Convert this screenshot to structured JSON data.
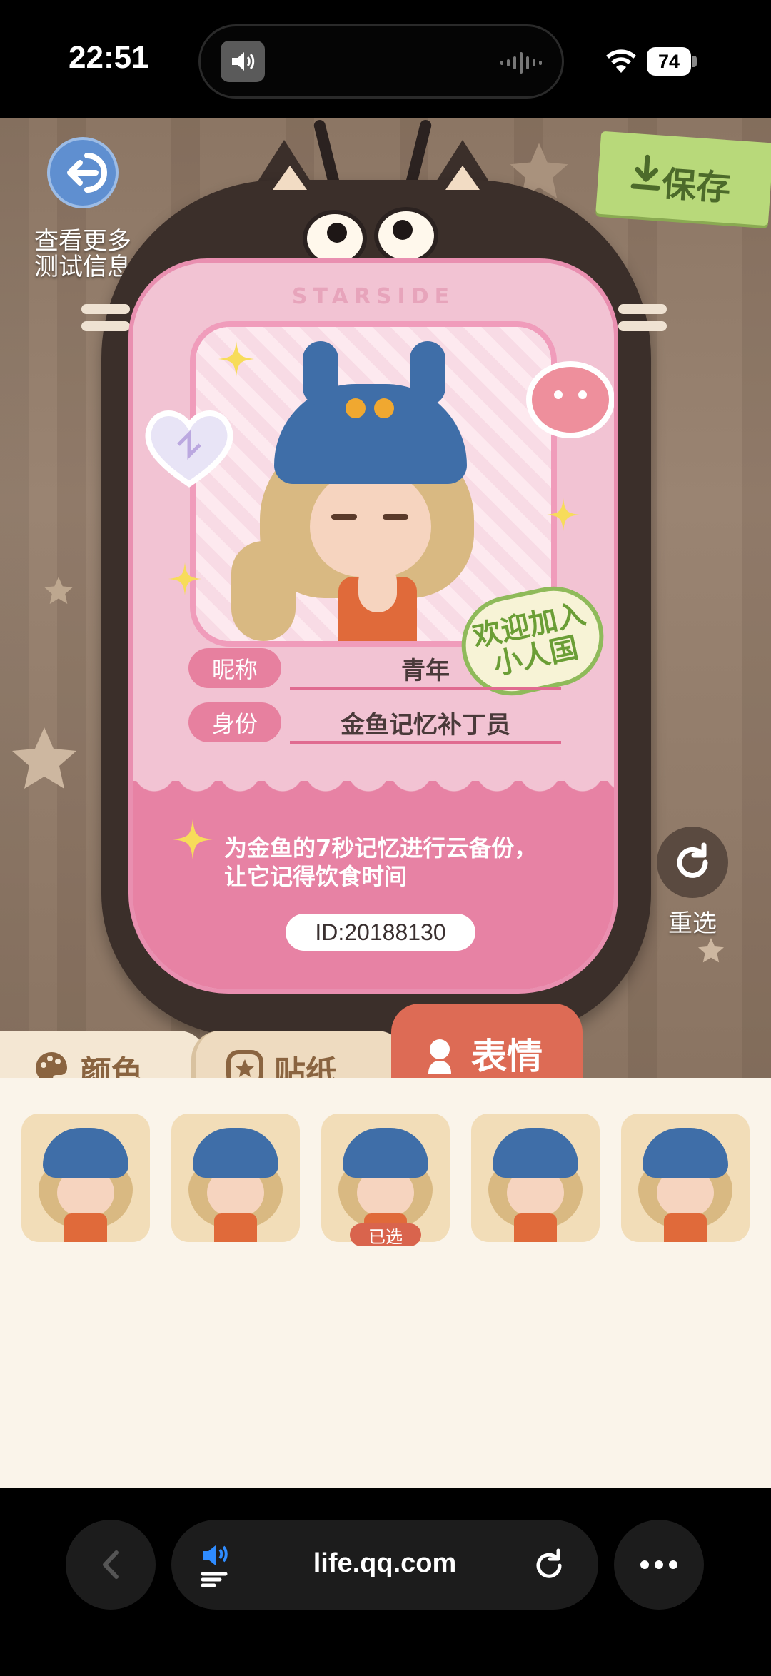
{
  "status_bar": {
    "time": "22:51",
    "battery": "74"
  },
  "page": {
    "more_info_label": "查看更多\n测试信息",
    "save_label": "保存",
    "brand": "STARSIDE",
    "welcome_sticker": "欢迎加入\n小人国",
    "nickname_label": "昵称",
    "nickname_value": "青年",
    "identity_label": "身份",
    "identity_value": "金鱼记忆补丁员",
    "description": "为金鱼的7秒记忆进行云备份，让它记得饮食时间",
    "id_text": "ID:20188130",
    "reselect_label": "重选"
  },
  "tabs": {
    "color": "颜色",
    "sticker": "贴纸",
    "expression": "表情",
    "active": "expression"
  },
  "expressions": {
    "selected_index": 2,
    "selected_label": "已选",
    "items": [
      "expression-1",
      "expression-2",
      "expression-3",
      "expression-4",
      "expression-5"
    ]
  },
  "browser": {
    "url": "life.qq.com"
  },
  "colors": {
    "card_pink": "#f2c3d3",
    "accent_red": "#dd6b55",
    "save_green": "#b8d97a"
  }
}
